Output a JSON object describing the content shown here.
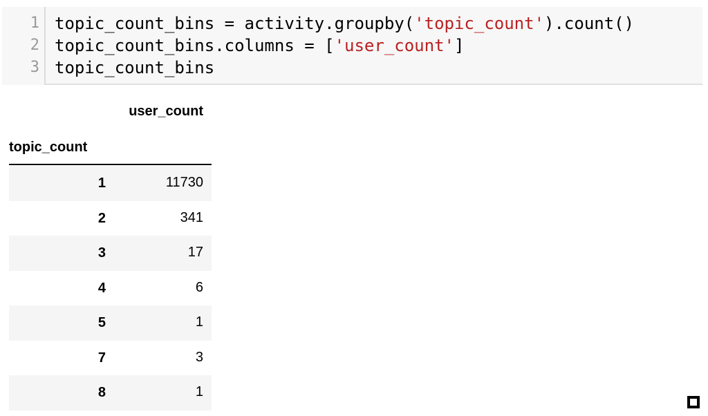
{
  "code_cell": {
    "lines": [
      {
        "number": "1",
        "segments": [
          {
            "text": "topic_count_bins = activity.groupby(",
            "kind": "code"
          },
          {
            "text": "'topic_count'",
            "kind": "string"
          },
          {
            "text": ").count()",
            "kind": "code"
          }
        ]
      },
      {
        "number": "2",
        "segments": [
          {
            "text": "topic_count_bins.columns = [",
            "kind": "code"
          },
          {
            "text": "'user_count'",
            "kind": "string"
          },
          {
            "text": "]",
            "kind": "code"
          }
        ]
      },
      {
        "number": "3",
        "segments": [
          {
            "text": "topic_count_bins",
            "kind": "code"
          }
        ]
      }
    ],
    "string_color": "#ba2121"
  },
  "output_table": {
    "column_header": "user_count",
    "index_header": "topic_count",
    "rows": [
      {
        "index": "1",
        "user_count": "11730"
      },
      {
        "index": "2",
        "user_count": "341"
      },
      {
        "index": "3",
        "user_count": "17"
      },
      {
        "index": "4",
        "user_count": "6"
      },
      {
        "index": "5",
        "user_count": "1"
      },
      {
        "index": "7",
        "user_count": "3"
      },
      {
        "index": "8",
        "user_count": "1"
      }
    ],
    "stripe_color": "#f5f5f5"
  },
  "corner_widget": {
    "icon": "square-icon"
  }
}
